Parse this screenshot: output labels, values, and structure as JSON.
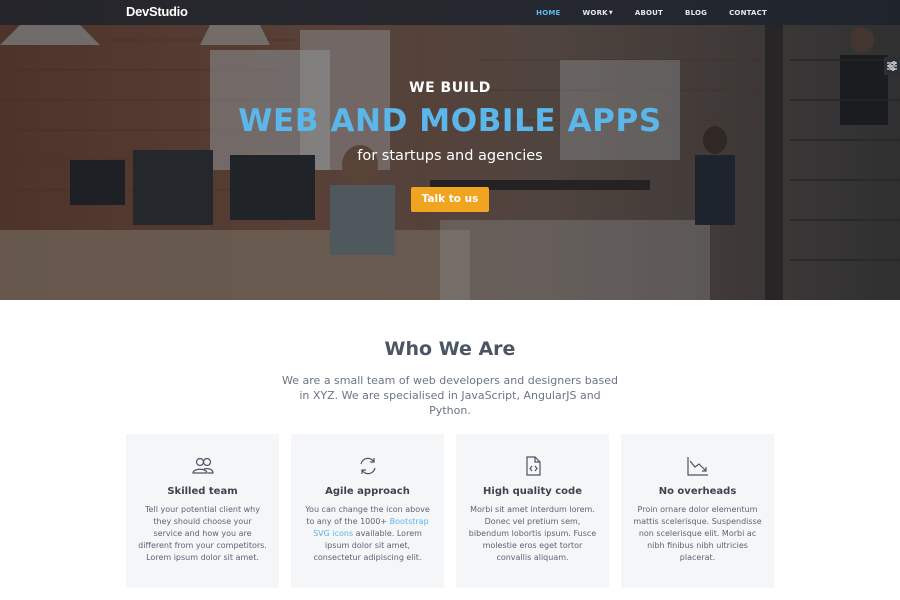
{
  "brand": {
    "logo": "DevStudio"
  },
  "nav": {
    "items": [
      {
        "label": "HOME",
        "active": true
      },
      {
        "label": "WORK",
        "dropdown": true
      },
      {
        "label": "ABOUT"
      },
      {
        "label": "BLOG"
      },
      {
        "label": "CONTACT"
      }
    ]
  },
  "hero": {
    "eyebrow": "WE BUILD",
    "headline": "WEB AND MOBILE APPS",
    "subline": "for startups and agencies",
    "cta_label": "Talk to us",
    "settings_icon": "sliders-icon"
  },
  "about": {
    "title": "Who We Are",
    "description": "We are a small team of web developers and designers based in XYZ. We are specialised in JavaScript, AngularJS and Python."
  },
  "features": [
    {
      "icon": "people-icon",
      "title": "Skilled team",
      "text": "Tell your potential client why they should choose your service and how you are different from your competitors. Lorem ipsum dolor sit amet."
    },
    {
      "icon": "refresh-icon",
      "title": "Agile approach",
      "text_before": "You can change the icon above to any of the 1000+",
      "link": "Bootstrap SVG icons",
      "text_after": "available. Lorem ipsum dolor sit amet, consectetur adipiscing elit."
    },
    {
      "icon": "code-file-icon",
      "title": "High quality code",
      "text": "Morbi sit amet interdum lorem. Donec vel pretium sem, bibendum lobortis ipsum. Fusce molestie eros eget tortor convallis aliquam."
    },
    {
      "icon": "graph-down-icon",
      "title": "No overheads",
      "text": "Proin ornare dolor elementum mattis scelerisque. Suspendisse non scelerisque elit. Morbi ac nibh finibus nibh ultricies placerat."
    }
  ],
  "colors": {
    "accent": "#5bb7ea",
    "cta": "#f0a420",
    "nav_bg": "#1c222c",
    "card_bg": "#f5f6f8"
  }
}
